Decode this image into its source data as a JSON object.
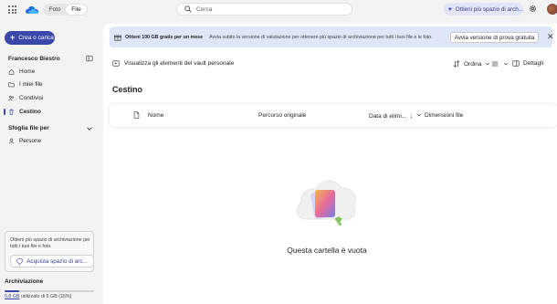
{
  "header": {
    "tabs": [
      {
        "label": "Foto",
        "selected": false
      },
      {
        "label": "File",
        "selected": true
      }
    ],
    "search_placeholder": "Cerca",
    "premium_label": "Ottieni più spazio di arch...",
    "icons": {
      "apps": "waffle-icon",
      "logo": "onedrive-logo",
      "settings": "gear-icon",
      "profile": "avatar"
    }
  },
  "sidebar": {
    "new_button": "Crea o carica",
    "user_name": "Francesco Biestro",
    "nav": [
      {
        "label": "Home",
        "icon": "home-icon",
        "active": false
      },
      {
        "label": "I miei file",
        "icon": "folder-icon",
        "active": false
      },
      {
        "label": "Condivisi",
        "icon": "people-icon",
        "active": false
      },
      {
        "label": "Cestino",
        "icon": "trash-icon",
        "active": true
      }
    ],
    "browse_header": "Sfoglia file per",
    "browse_items": [
      {
        "label": "Persone",
        "icon": "person-icon"
      }
    ],
    "upsell_text": "Ottieni più spazio di archiviazione per tutti i tuoi file e foto.",
    "upsell_button": "Acquista spazio di arc...",
    "storage_title": "Archiviazione",
    "storage_used": "0,8 GB",
    "storage_text": "utilizzato di 5 GB (16%)",
    "storage_percent": 16
  },
  "banner": {
    "bold": "Ottieni 100 GB gratis per un mese",
    "text": "Avvia subito la versione di valutazione per ottenere più spazio di archiviazione per tutti i tuoi file e le foto.",
    "button": "Avvia versione di prova gratuita",
    "close": "✕"
  },
  "toolbar": {
    "vault": "Visualizza gli elementi del vault personale",
    "sort": "Ordina",
    "view_icon": "list-view-icon",
    "details": "Dettagli"
  },
  "main": {
    "title": "Cestino",
    "columns": [
      "Nome",
      "Percorso originale",
      "Data di elimi...",
      "Dimensioni file"
    ],
    "empty_message": "Questa cartella è vuota"
  },
  "colors": {
    "accent": "#3a46a8",
    "premium_bg": "#e3e5f6",
    "banner_bg": "#dfe6f7"
  }
}
